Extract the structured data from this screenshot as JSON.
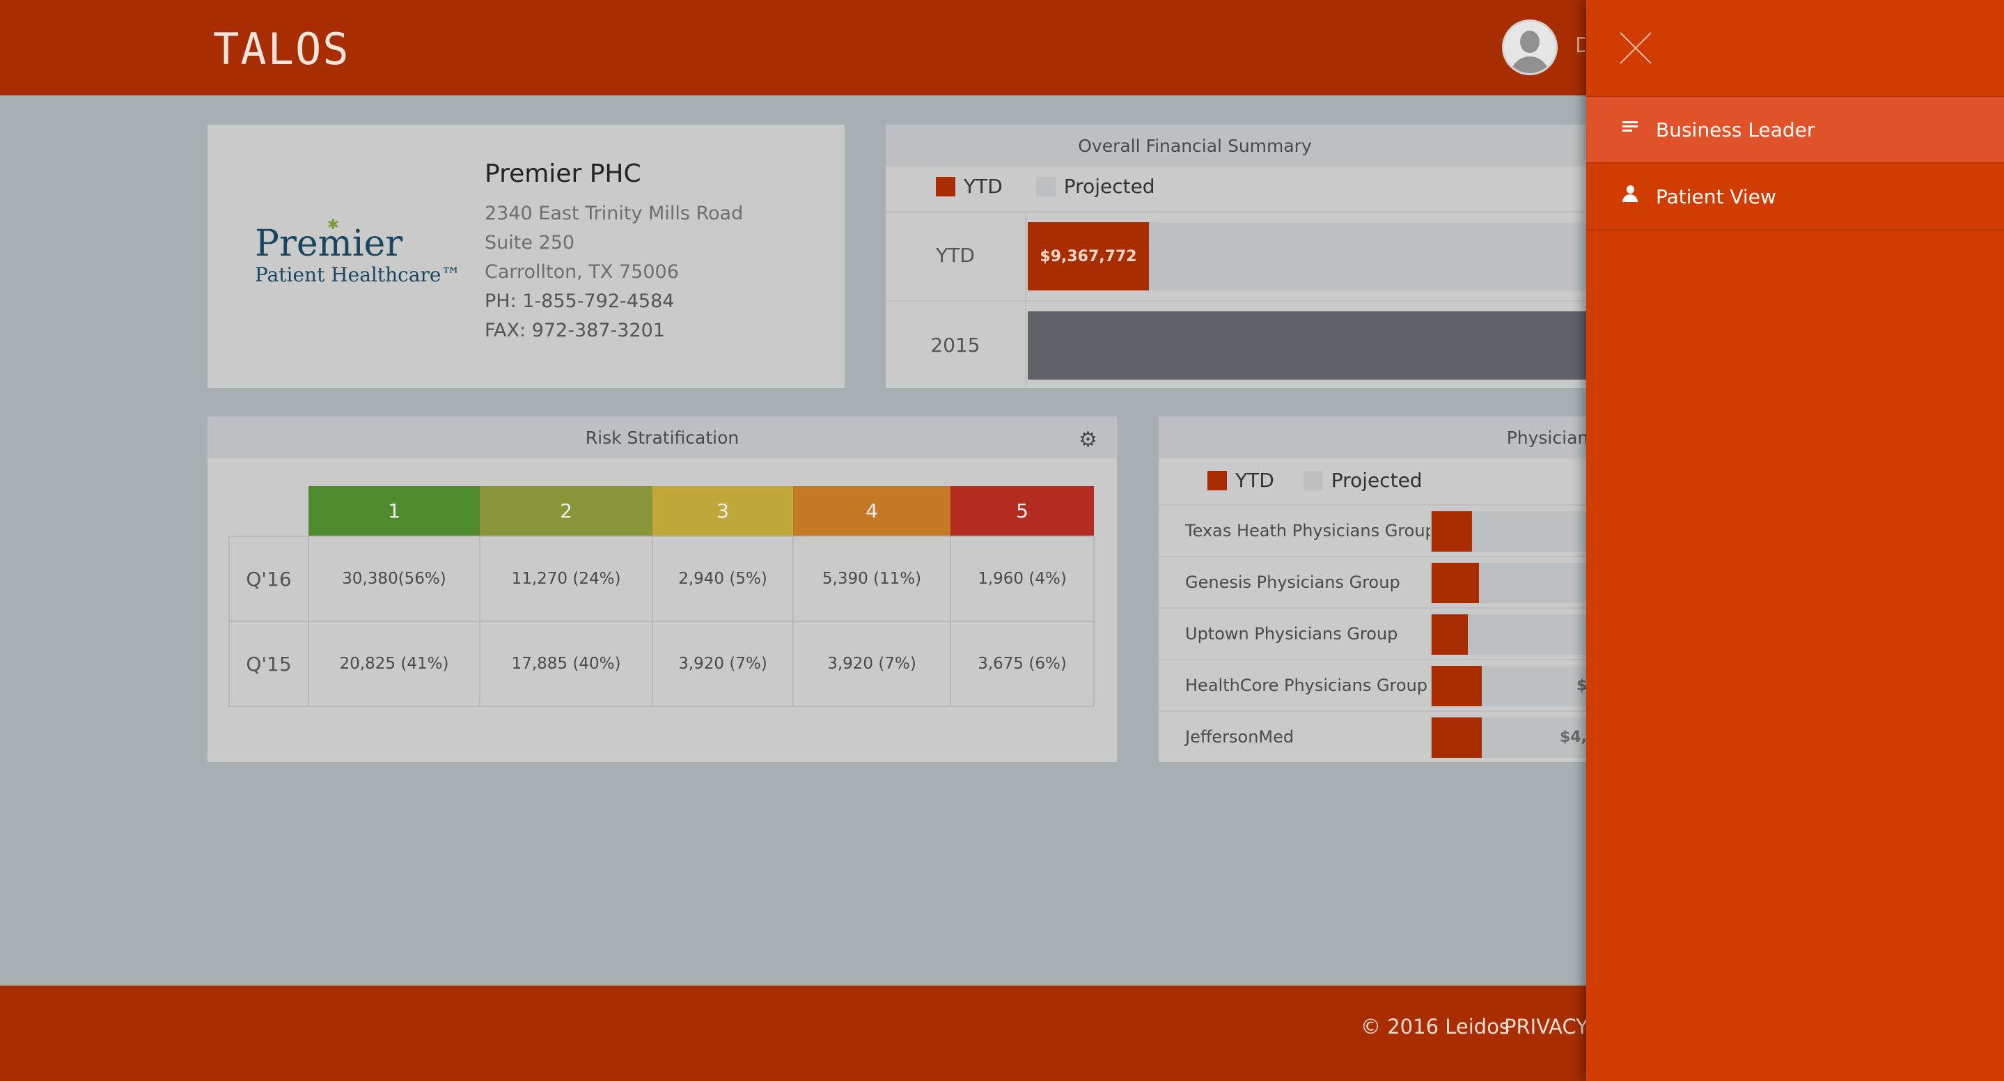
{
  "app": {
    "logo_text": "TALOS",
    "user_initial": "D"
  },
  "organization": {
    "logo_line1": "Premier",
    "logo_line2": "Patient Healthcare™",
    "name": "Premier PHC",
    "address1": "2340 East Trinity Mills Road",
    "address2": "Suite 250",
    "city_state_zip": "Carrollton, TX 75006",
    "phone": "PH: 1-855-792-4584",
    "fax": "FAX: 972-387-3201"
  },
  "financial_summary": {
    "title": "Overall Financial Summary",
    "legend_ytd": "YTD",
    "legend_projected": "Projected",
    "rows": [
      {
        "label": "YTD",
        "value_label": "$9,367,772"
      },
      {
        "label": "2015",
        "value_label": ""
      }
    ]
  },
  "risk_stratification": {
    "title": "Risk Stratification",
    "tiers": [
      {
        "label": "1",
        "color": "#4e8b2c"
      },
      {
        "label": "2",
        "color": "#8a9438"
      },
      {
        "label": "3",
        "color": "#c0a93a"
      },
      {
        "label": "4",
        "color": "#c57924"
      },
      {
        "label": "5",
        "color": "#b42b20"
      }
    ],
    "rows": [
      {
        "label": "Q'16",
        "values": [
          "30,380(56%)",
          "11,270 (24%)",
          "2,940 (5%)",
          "5,390 (11%)",
          "1,960 (4%)"
        ]
      },
      {
        "label": "Q'15",
        "values": [
          "20,825 (41%)",
          "17,885 (40%)",
          "3,920 (7%)",
          "3,920 (7%)",
          "3,675 (6%)"
        ]
      }
    ]
  },
  "physician_groups": {
    "title": "Physician Groups",
    "legend_ytd": "YTD",
    "legend_projected": "Projected",
    "groups": [
      {
        "name": "Texas Heath Physicians Group",
        "value_label": ""
      },
      {
        "name": "Genesis Physicians Group",
        "value_label": ""
      },
      {
        "name": "Uptown Physicians Group",
        "value_label": ""
      },
      {
        "name": "HealthCore Physicians Group",
        "value_label": "$"
      },
      {
        "name": "JeffersonMed",
        "value_label": "$4,"
      }
    ]
  },
  "footer": {
    "copyright": "© 2016 Leidos",
    "privacy": "PRIVACY"
  },
  "drawer": {
    "menu": [
      {
        "label": "Business Leader",
        "icon": "lines-icon",
        "active": true
      },
      {
        "label": "Patient View",
        "icon": "person-icon",
        "active": false
      }
    ]
  },
  "colors": {
    "brand": "#a82d00",
    "drawer": "#d13c00",
    "drawer_active": "#e0532a",
    "projected": "#bdc0c2",
    "dark_bar": "#5f6266"
  }
}
